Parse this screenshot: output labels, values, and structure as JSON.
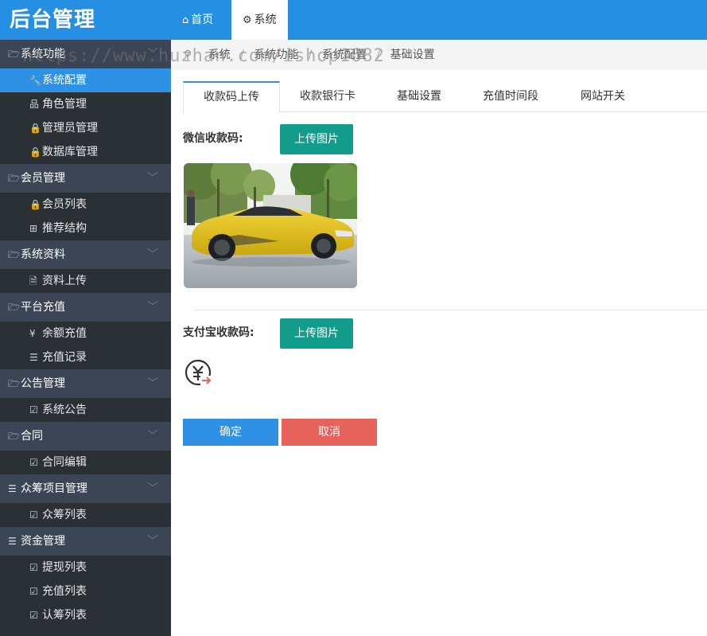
{
  "app": {
    "logo": "后台管理"
  },
  "topnav": [
    {
      "label": "首页",
      "icon": "home-icon"
    },
    {
      "label": "系统",
      "icon": "gear-icon"
    }
  ],
  "breadcrumb": [
    "系统",
    "系统功能",
    "系统配置",
    "基础设置"
  ],
  "watermark": "https://www.huzhan.com/ishop1682",
  "sidebar": {
    "groups": [
      {
        "label": "系统功能",
        "icon": "folder-open-icon",
        "items": [
          {
            "label": "系统配置",
            "icon": "wrench-icon",
            "active": true
          },
          {
            "label": "角色管理",
            "icon": "sitemap-icon"
          },
          {
            "label": "管理员管理",
            "icon": "lock-icon"
          },
          {
            "label": "数据库管理",
            "icon": "lock-icon"
          }
        ]
      },
      {
        "label": "会员管理",
        "icon": "folder-open-icon",
        "items": [
          {
            "label": "会员列表",
            "icon": "lock-icon"
          },
          {
            "label": "推荐结构",
            "icon": "grid-icon"
          }
        ]
      },
      {
        "label": "系统资料",
        "icon": "folder-open-icon",
        "items": [
          {
            "label": "资料上传",
            "icon": "document-icon"
          }
        ]
      },
      {
        "label": "平台充值",
        "icon": "folder-open-icon",
        "items": [
          {
            "label": "余额充值",
            "icon": "yen-icon"
          },
          {
            "label": "充值记录",
            "icon": "list-icon"
          }
        ]
      },
      {
        "label": "公告管理",
        "icon": "folder-open-icon",
        "items": [
          {
            "label": "系统公告",
            "icon": "edit-icon"
          }
        ]
      },
      {
        "label": "合同",
        "icon": "folder-open-icon",
        "items": [
          {
            "label": "合同编辑",
            "icon": "edit-icon"
          }
        ]
      },
      {
        "label": "众筹项目管理",
        "icon": "list-icon",
        "items": [
          {
            "label": "众筹列表",
            "icon": "edit-icon"
          }
        ]
      },
      {
        "label": "资金管理",
        "icon": "list-icon",
        "items": [
          {
            "label": "提现列表",
            "icon": "edit-icon"
          },
          {
            "label": "充值列表",
            "icon": "edit-icon"
          },
          {
            "label": "认筹列表",
            "icon": "edit-icon"
          }
        ]
      }
    ]
  },
  "tabs": [
    "收款码上传",
    "收款银行卡",
    "基础设置",
    "充值时间段",
    "网站开关"
  ],
  "form": {
    "wechat_label": "微信收款码:",
    "alipay_label": "支付宝收款码:",
    "upload_label": "上传图片",
    "confirm_label": "确定",
    "cancel_label": "取消"
  },
  "colors": {
    "primary": "#2590e3",
    "upload": "#129c8c",
    "danger": "#e7625a",
    "sidebar_bg": "#2b3035",
    "sidebar_group": "#3b4555"
  }
}
